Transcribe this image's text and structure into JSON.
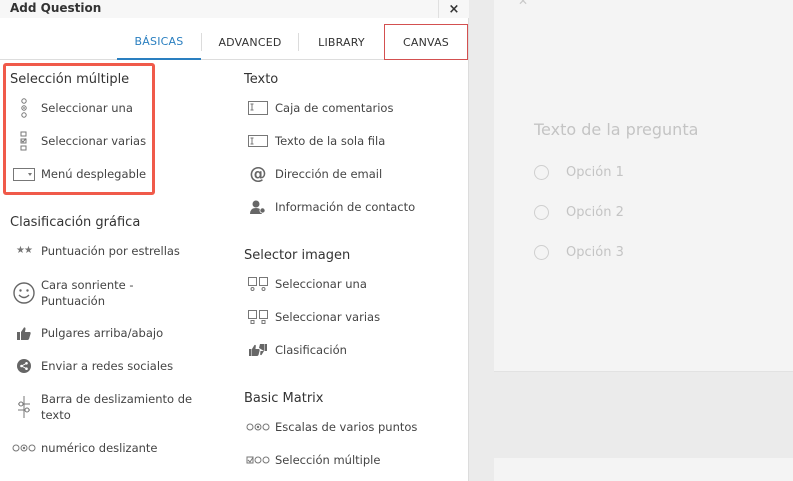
{
  "dialog": {
    "title": "Add Question",
    "close_symbol": "×"
  },
  "tabs": [
    {
      "label": "BÁSICAS",
      "active": true
    },
    {
      "label": "ADVANCED",
      "active": false
    },
    {
      "label": "LIBRARY",
      "active": false
    },
    {
      "label": "CANVAS",
      "active": false
    }
  ],
  "left_column": {
    "multiple_choice": {
      "title": "Selección múltiple",
      "items": [
        {
          "label": "Seleccionar una",
          "icon": "radio-stack-icon"
        },
        {
          "label": "Seleccionar varias",
          "icon": "checkbox-stack-icon"
        },
        {
          "label": "Menú desplegable",
          "icon": "dropdown-icon"
        }
      ]
    },
    "rating": {
      "title": "Clasificación gráfica",
      "items": [
        {
          "label": "Puntuación por estrellas",
          "icon": "stars-icon"
        },
        {
          "label_line1": "Cara sonriente -",
          "label_line2": "Puntuación",
          "icon": "smiley-icon"
        },
        {
          "label": "Pulgares arriba/abajo",
          "icon": "thumbs-icon"
        },
        {
          "label": "Enviar a redes sociales",
          "icon": "share-icon"
        },
        {
          "label_line1": "Barra de deslizamiento de",
          "label_line2": "texto",
          "icon": "slider-icon"
        },
        {
          "label": "numérico deslizante",
          "icon": "numeric-slider-icon"
        }
      ]
    }
  },
  "right_column": {
    "text": {
      "title": "Texto",
      "items": [
        {
          "label": "Caja de comentarios",
          "icon": "comment-box-icon"
        },
        {
          "label": "Texto de la sola fila",
          "icon": "single-line-icon"
        },
        {
          "label": "Dirección de email",
          "icon": "at-icon"
        },
        {
          "label": "Información de contacto",
          "icon": "contact-icon"
        }
      ]
    },
    "image_selector": {
      "title": "Selector imagen",
      "items": [
        {
          "label": "Seleccionar una",
          "icon": "image-single-icon"
        },
        {
          "label": "Seleccionar varias",
          "icon": "image-multi-icon"
        },
        {
          "label": "Clasificación",
          "icon": "image-rating-icon"
        }
      ]
    },
    "basic_matrix": {
      "title": "Basic Matrix",
      "items": [
        {
          "label": "Escalas de varios puntos",
          "icon": "multipoint-icon"
        },
        {
          "label": "Selección múltiple",
          "icon": "matrix-multi-icon"
        }
      ]
    }
  },
  "canvas": {
    "question_text": "Texto de la pregunta",
    "options": [
      "Opción 1",
      "Opción 2",
      "Opción 3"
    ]
  },
  "colors": {
    "accent": "#2a7fc0",
    "highlight": "#f05a4a"
  }
}
